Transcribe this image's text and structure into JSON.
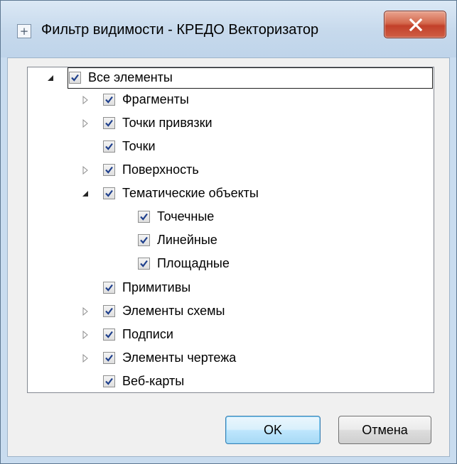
{
  "window": {
    "title": "Фильтр видимости - КРЕДО Векторизатор",
    "system_icon": "plus-box-icon",
    "close_icon": "close-icon",
    "close_color": "#c9462c"
  },
  "tree": {
    "items": [
      {
        "label": "Все элементы",
        "checked": true,
        "expander": "expanded"
      },
      {
        "label": "Фрагменты",
        "checked": true,
        "expander": "collapsed"
      },
      {
        "label": "Точки привязки",
        "checked": true,
        "expander": "collapsed"
      },
      {
        "label": "Точки",
        "checked": true,
        "expander": "none"
      },
      {
        "label": "Поверхность",
        "checked": true,
        "expander": "collapsed"
      },
      {
        "label": "Тематические объекты",
        "checked": true,
        "expander": "expanded"
      },
      {
        "label": "Точечные",
        "checked": true,
        "expander": "none"
      },
      {
        "label": "Линейные",
        "checked": true,
        "expander": "none"
      },
      {
        "label": "Площадные",
        "checked": true,
        "expander": "none"
      },
      {
        "label": "Примитивы",
        "checked": true,
        "expander": "none"
      },
      {
        "label": "Элементы схемы",
        "checked": true,
        "expander": "collapsed"
      },
      {
        "label": "Подписи",
        "checked": true,
        "expander": "collapsed"
      },
      {
        "label": "Элементы чертежа",
        "checked": true,
        "expander": "collapsed"
      },
      {
        "label": "Веб-карты",
        "checked": true,
        "expander": "none"
      }
    ],
    "selected": "Все элементы"
  },
  "buttons": {
    "ok_label": "OK",
    "cancel_label": "Отмена"
  }
}
